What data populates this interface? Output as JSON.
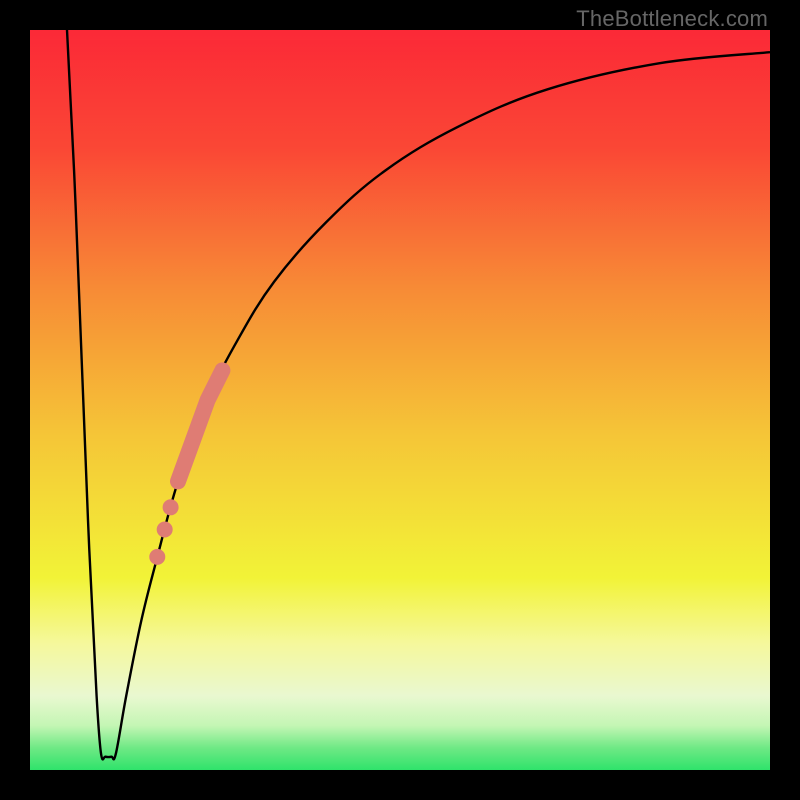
{
  "watermark": "TheBottleneck.com",
  "chart_data": {
    "type": "line",
    "title": "",
    "xlabel": "",
    "ylabel": "",
    "xlim": [
      0,
      100
    ],
    "ylim": [
      0,
      100
    ],
    "grid": false,
    "legend": false,
    "gradient_stops": [
      {
        "offset": 0.0,
        "color": "#fb2937"
      },
      {
        "offset": 0.16,
        "color": "#fa4735"
      },
      {
        "offset": 0.35,
        "color": "#f78b36"
      },
      {
        "offset": 0.55,
        "color": "#f5c637"
      },
      {
        "offset": 0.74,
        "color": "#f2f337"
      },
      {
        "offset": 0.83,
        "color": "#f5f89d"
      },
      {
        "offset": 0.9,
        "color": "#e9f8d0"
      },
      {
        "offset": 0.94,
        "color": "#c4f6b4"
      },
      {
        "offset": 0.97,
        "color": "#6fe985"
      },
      {
        "offset": 1.0,
        "color": "#2fe36b"
      }
    ],
    "series": [
      {
        "name": "bottleneck-curve",
        "color": "#000000",
        "points": [
          {
            "x": 5.0,
            "y": 100.0
          },
          {
            "x": 6.0,
            "y": 80.0
          },
          {
            "x": 7.0,
            "y": 55.0
          },
          {
            "x": 8.0,
            "y": 30.0
          },
          {
            "x": 9.0,
            "y": 10.0
          },
          {
            "x": 9.6,
            "y": 2.2
          },
          {
            "x": 10.2,
            "y": 1.8
          },
          {
            "x": 11.0,
            "y": 1.8
          },
          {
            "x": 11.6,
            "y": 2.2
          },
          {
            "x": 13.0,
            "y": 10.0
          },
          {
            "x": 15.0,
            "y": 20.0
          },
          {
            "x": 17.0,
            "y": 28.0
          },
          {
            "x": 20.0,
            "y": 39.0
          },
          {
            "x": 24.0,
            "y": 50.0
          },
          {
            "x": 28.0,
            "y": 58.0
          },
          {
            "x": 33.0,
            "y": 66.0
          },
          {
            "x": 40.0,
            "y": 74.0
          },
          {
            "x": 48.0,
            "y": 81.0
          },
          {
            "x": 58.0,
            "y": 87.0
          },
          {
            "x": 70.0,
            "y": 92.0
          },
          {
            "x": 85.0,
            "y": 95.5
          },
          {
            "x": 100.0,
            "y": 97.0
          }
        ]
      },
      {
        "name": "highlight-band",
        "color": "#df7c74",
        "segment_type": "thick-line",
        "points": [
          {
            "x": 20.0,
            "y": 39.0
          },
          {
            "x": 24.0,
            "y": 50.0
          },
          {
            "x": 26.0,
            "y": 54.0
          }
        ]
      },
      {
        "name": "highlight-dots",
        "color": "#df7c74",
        "segment_type": "dots",
        "points": [
          {
            "x": 19.0,
            "y": 35.5
          },
          {
            "x": 18.2,
            "y": 32.5
          },
          {
            "x": 17.2,
            "y": 28.8
          }
        ]
      }
    ]
  }
}
